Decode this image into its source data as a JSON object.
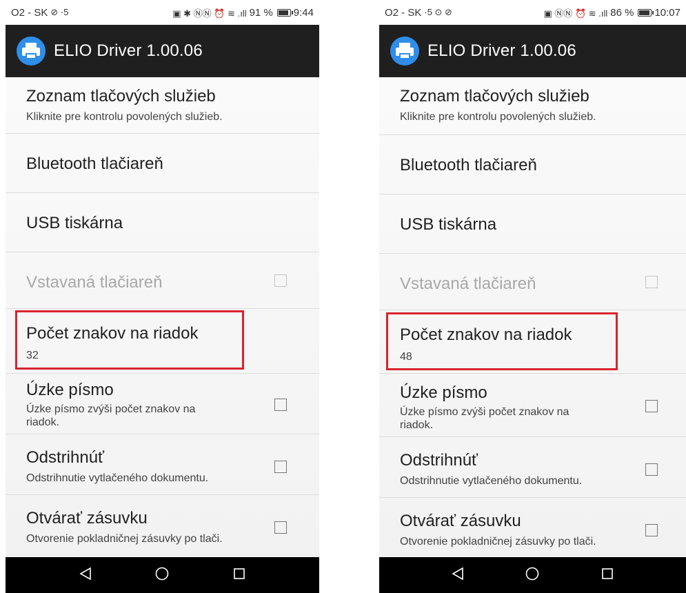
{
  "screens": [
    {
      "status": {
        "left": "O2 - SK",
        "left_glyphs": "⊘ ·5",
        "right_glyphs": "▣ ✱ ⓃⓃ ⏰ ≋ .ıll",
        "battery": "91 %",
        "time": "9:44"
      },
      "app_title": "ELIO Driver 1.00.06",
      "items": [
        {
          "title": "Zoznam tlačových služieb",
          "subtitle": "Kliknite pre kontrolu povolených služieb."
        },
        {
          "title": "Bluetooth tlačiareň"
        },
        {
          "title": "USB tiskárna"
        },
        {
          "title": "Vstavaná tlačiareň",
          "disabled": true
        },
        {
          "title": "Počet znakov na riadok",
          "subtitle": "32"
        },
        {
          "title": "Úzke písmo",
          "subtitle": "Úzke písmo zvýši počet znakov na riadok."
        },
        {
          "title": "Odstrihnúť",
          "subtitle": "Odstrihnutie vytlačeného dokumentu."
        },
        {
          "title": "Otvárať zásuvku",
          "subtitle": "Otvorenie pokladničnej zásuvky po tlači."
        }
      ]
    },
    {
      "status": {
        "left": "O2 - SK",
        "left_glyphs": "·5 ⊙ ⊘",
        "right_glyphs": "▣ ⓃⓃ ⏰ ≋ .ıll",
        "battery": "86 %",
        "time": "10:07"
      },
      "app_title": "ELIO Driver 1.00.06",
      "items": [
        {
          "title": "Zoznam tlačových služieb",
          "subtitle": "Kliknite pre kontrolu povolených služieb."
        },
        {
          "title": "Bluetooth tlačiareň"
        },
        {
          "title": "USB tiskárna"
        },
        {
          "title": "Vstavaná tlačiareň",
          "disabled": true
        },
        {
          "title": "Počet znakov na riadok",
          "subtitle": "48"
        },
        {
          "title": "Úzke písmo",
          "subtitle": "Úzke písmo zvýši počet znakov na riadok."
        },
        {
          "title": "Odstrihnúť",
          "subtitle": "Odstrihnutie vytlačeného dokumentu."
        },
        {
          "title": "Otvárať zásuvku",
          "subtitle": "Otvorenie pokladničnej zásuvky po tlači."
        }
      ]
    }
  ],
  "colors": {
    "appbar": "#1f1f1f",
    "accent": "#2e8ee8",
    "highlight": "#d9232d",
    "navbar": "#000000"
  }
}
